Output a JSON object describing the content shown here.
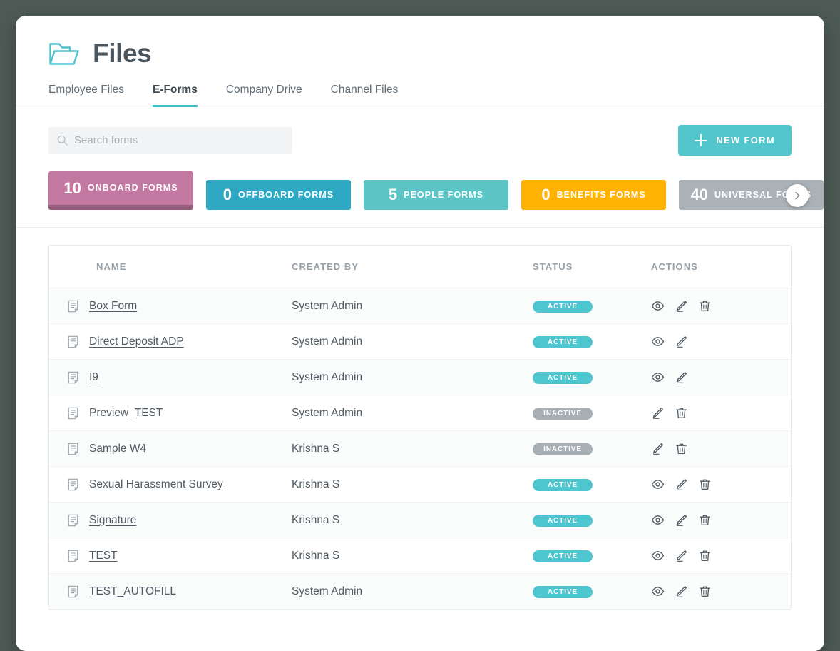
{
  "window": {
    "background_color": "#4d5a55",
    "card_color": "#ffffff"
  },
  "header": {
    "title": "Files",
    "folder_icon": "folder-icon",
    "accent_color": "#41bfcd"
  },
  "tabs": [
    {
      "label": "Employee Files",
      "active": false
    },
    {
      "label": "E-Forms",
      "active": true
    },
    {
      "label": "Company Drive",
      "active": false
    },
    {
      "label": "Channel Files",
      "active": false
    }
  ],
  "search": {
    "placeholder": "Search forms",
    "value": "",
    "icon": "search-icon"
  },
  "new_form_button": {
    "label": "NEW FORM",
    "icon": "plus-icon",
    "color": "#53c5cd"
  },
  "chips": [
    {
      "count": "10",
      "label": "ONBOARD FORMS",
      "color": "#c278a0",
      "selected": true
    },
    {
      "count": "0",
      "label": "OFFBOARD FORMS",
      "color": "#2fa8c4",
      "selected": false
    },
    {
      "count": "5",
      "label": "PEOPLE FORMS",
      "color": "#5cc4c4",
      "selected": false
    },
    {
      "count": "0",
      "label": "BENEFITS FORMS",
      "color": "#ffb300",
      "selected": false
    },
    {
      "count": "40",
      "label": "UNIVERSAL FORMS",
      "color": "#aab2b8",
      "selected": false
    }
  ],
  "chips_next_button": {
    "icon": "chevron-right-icon"
  },
  "table": {
    "columns": [
      "NAME",
      "CREATED BY",
      "STATUS",
      "ACTIONS"
    ],
    "rows": [
      {
        "name": "Box Form",
        "is_link": true,
        "created_by": "System Admin",
        "status": "ACTIVE",
        "actions": [
          "view",
          "edit",
          "delete"
        ]
      },
      {
        "name": "Direct Deposit ADP",
        "is_link": true,
        "created_by": "System Admin",
        "status": "ACTIVE",
        "actions": [
          "view",
          "edit"
        ]
      },
      {
        "name": "I9",
        "is_link": true,
        "created_by": "System Admin",
        "status": "ACTIVE",
        "actions": [
          "view",
          "edit"
        ]
      },
      {
        "name": "Preview_TEST",
        "is_link": false,
        "created_by": "System Admin",
        "status": "INACTIVE",
        "actions": [
          "edit",
          "delete"
        ]
      },
      {
        "name": "Sample W4",
        "is_link": false,
        "created_by": "Krishna S",
        "status": "INACTIVE",
        "actions": [
          "edit",
          "delete"
        ]
      },
      {
        "name": "Sexual Harassment Survey",
        "is_link": true,
        "created_by": "Krishna S",
        "status": "ACTIVE",
        "actions": [
          "view",
          "edit",
          "delete"
        ]
      },
      {
        "name": "Signature",
        "is_link": true,
        "created_by": "Krishna S",
        "status": "ACTIVE",
        "actions": [
          "view",
          "edit",
          "delete"
        ]
      },
      {
        "name": "TEST",
        "is_link": true,
        "created_by": "Krishna S",
        "status": "ACTIVE",
        "actions": [
          "view",
          "edit",
          "delete"
        ]
      },
      {
        "name": "TEST_AUTOFILL",
        "is_link": true,
        "created_by": "System Admin",
        "status": "ACTIVE",
        "actions": [
          "view",
          "edit",
          "delete"
        ]
      }
    ]
  }
}
